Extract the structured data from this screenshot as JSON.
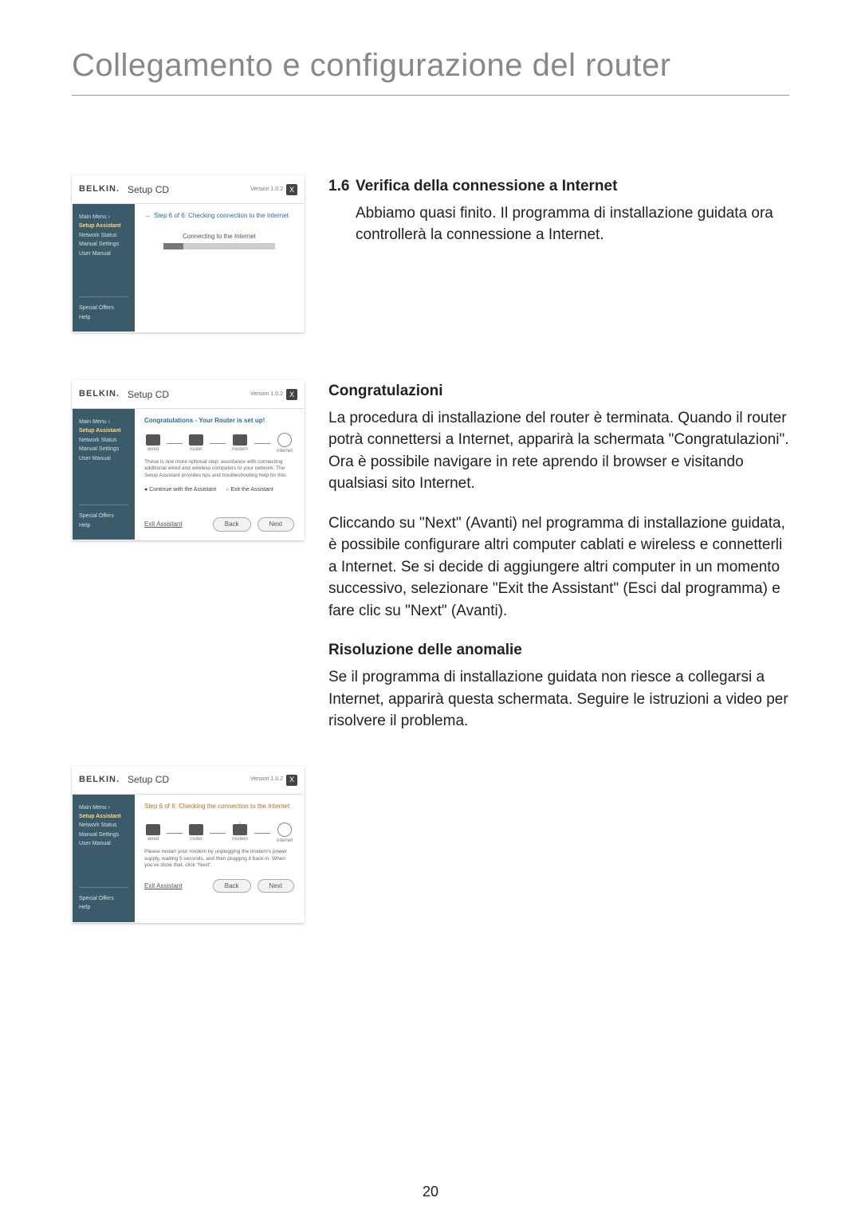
{
  "page_title": "Collegamento e configurazione del router",
  "page_number": "20",
  "shots": {
    "common": {
      "brand": "BELKIN.",
      "title": "Setup CD",
      "version": "Version 1.0.2",
      "close": "X",
      "sidebar_top": {
        "main": "Main Menu  ›",
        "assistant": "Setup Assistant",
        "status": "Network Status",
        "manual_setup": "Manual Settings",
        "manual": "User Manual"
      },
      "sidebar_bot": {
        "offers": "Special Offers",
        "help": "Help"
      },
      "exit": "Exit Assistant",
      "back": "Back",
      "next": "Next"
    },
    "shot1": {
      "step": "Step 6 of 6: Checking connection to the Internet",
      "connecting": "Connecting to the Internet"
    },
    "shot2": {
      "congr": "Congratulations - Your Router is set up!",
      "labels": {
        "wired": "wired",
        "router": "router",
        "modem": "modem",
        "internet": "internet"
      },
      "note": "These is one more optional step: assistance with connecting additional wired and wireless computers to your network. The Setup Assistant provides tips and troubleshooting help for this.",
      "opt_continue": "Continue with the Assistant",
      "opt_exit": "Exit the Assistant"
    },
    "shot3": {
      "step": "Step 6 of 6: Checking the connection to the Internet",
      "labels": {
        "wired": "wired",
        "router": "router",
        "modem": "modem",
        "internet": "internet"
      },
      "note": "Please restart your modem by unplugging the modem's power supply, waiting 5 seconds, and then plugging it back in. When you've done that, click \"Next\"."
    }
  },
  "sections": {
    "s1": {
      "num": "1.6",
      "head": "Verifica della connessione a Internet",
      "body": "Abbiamo quasi finito. Il programma di installazione guidata ora controllerà la connessione a Internet."
    },
    "s2": {
      "head": "Congratulazioni",
      "p1": "La procedura di installazione del router è terminata. Quando il router potrà connettersi a Internet, apparirà la schermata \"Congratulazioni\". Ora è possibile navigare in rete aprendo il browser e visitando qualsiasi sito Internet.",
      "p2": "Cliccando su \"Next\" (Avanti) nel programma di installazione guidata, è possibile configurare altri computer cablati e wireless e connetterli a Internet. Se si decide di aggiungere altri computer in un momento successivo, selezionare \"Exit the Assistant\" (Esci dal programma) e fare clic su \"Next\" (Avanti)."
    },
    "s3": {
      "head": "Risoluzione delle anomalie",
      "body": "Se il programma di installazione guidata non riesce a collegarsi a Internet, apparirà questa schermata. Seguire le istruzioni a video per risolvere il problema."
    }
  }
}
